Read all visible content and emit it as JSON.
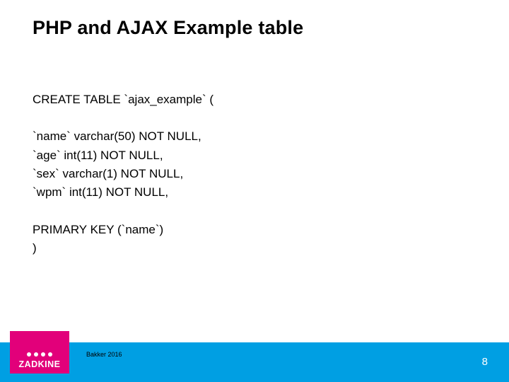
{
  "title": "PHP and AJAX Example table",
  "code": {
    "l1": "CREATE TABLE `ajax_example` (",
    "c1": "`name` varchar(50) NOT NULL,",
    "c2": "`age` int(11) NOT NULL,",
    "c3": "`sex` varchar(1) NOT NULL,",
    "c4": "`wpm` int(11) NOT NULL,",
    "pk": "PRIMARY KEY (`name`)",
    "end": ")"
  },
  "footer": {
    "credit": "Bakker 2016",
    "page": "8",
    "logo_text": "ZADKINE"
  }
}
